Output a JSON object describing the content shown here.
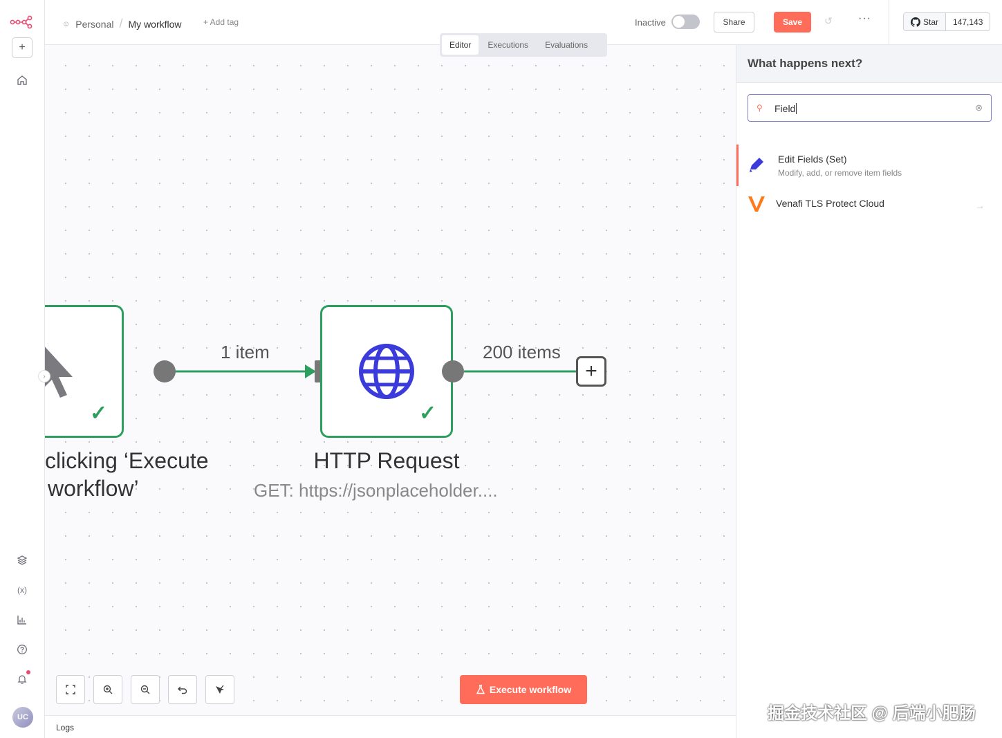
{
  "header": {
    "project": "Personal",
    "workflow_name": "My workflow",
    "add_tag": "+ Add tag",
    "status_label": "Inactive",
    "active": false,
    "share": "Share",
    "save": "Save",
    "more": "···",
    "github_star": "Star",
    "github_count": "147,143"
  },
  "tabs": [
    {
      "label": "Editor",
      "active": true
    },
    {
      "label": "Executions",
      "active": false
    },
    {
      "label": "Evaluations",
      "active": false
    }
  ],
  "canvas": {
    "trigger_title_line1": "clicking ‘Execute",
    "trigger_title_line2": "workflow’",
    "edge1_label": "1 item",
    "http_title": "HTTP Request",
    "http_subtitle": "GET: https://jsonplaceholder....",
    "edge2_label": "200 items",
    "execute_button": "Execute workflow",
    "node_status": "success"
  },
  "logs": {
    "label": "Logs"
  },
  "panel": {
    "title": "What happens next?",
    "search_value": "Field",
    "results": [
      {
        "name": "Edit Fields (Set)",
        "description": "Modify, add, or remove item fields",
        "icon": "pencil-icon",
        "selected": true
      },
      {
        "name": "Venafi TLS Protect Cloud",
        "description": "",
        "icon": "venafi-logo-icon",
        "selected": false
      }
    ]
  },
  "user": {
    "initials": "UC"
  },
  "watermark": "掘金技术社区 @ 后端小肥肠",
  "colors": {
    "accent": "#ff6d5a",
    "success": "#2c9f5e",
    "http_icon": "#3b3bdb"
  }
}
